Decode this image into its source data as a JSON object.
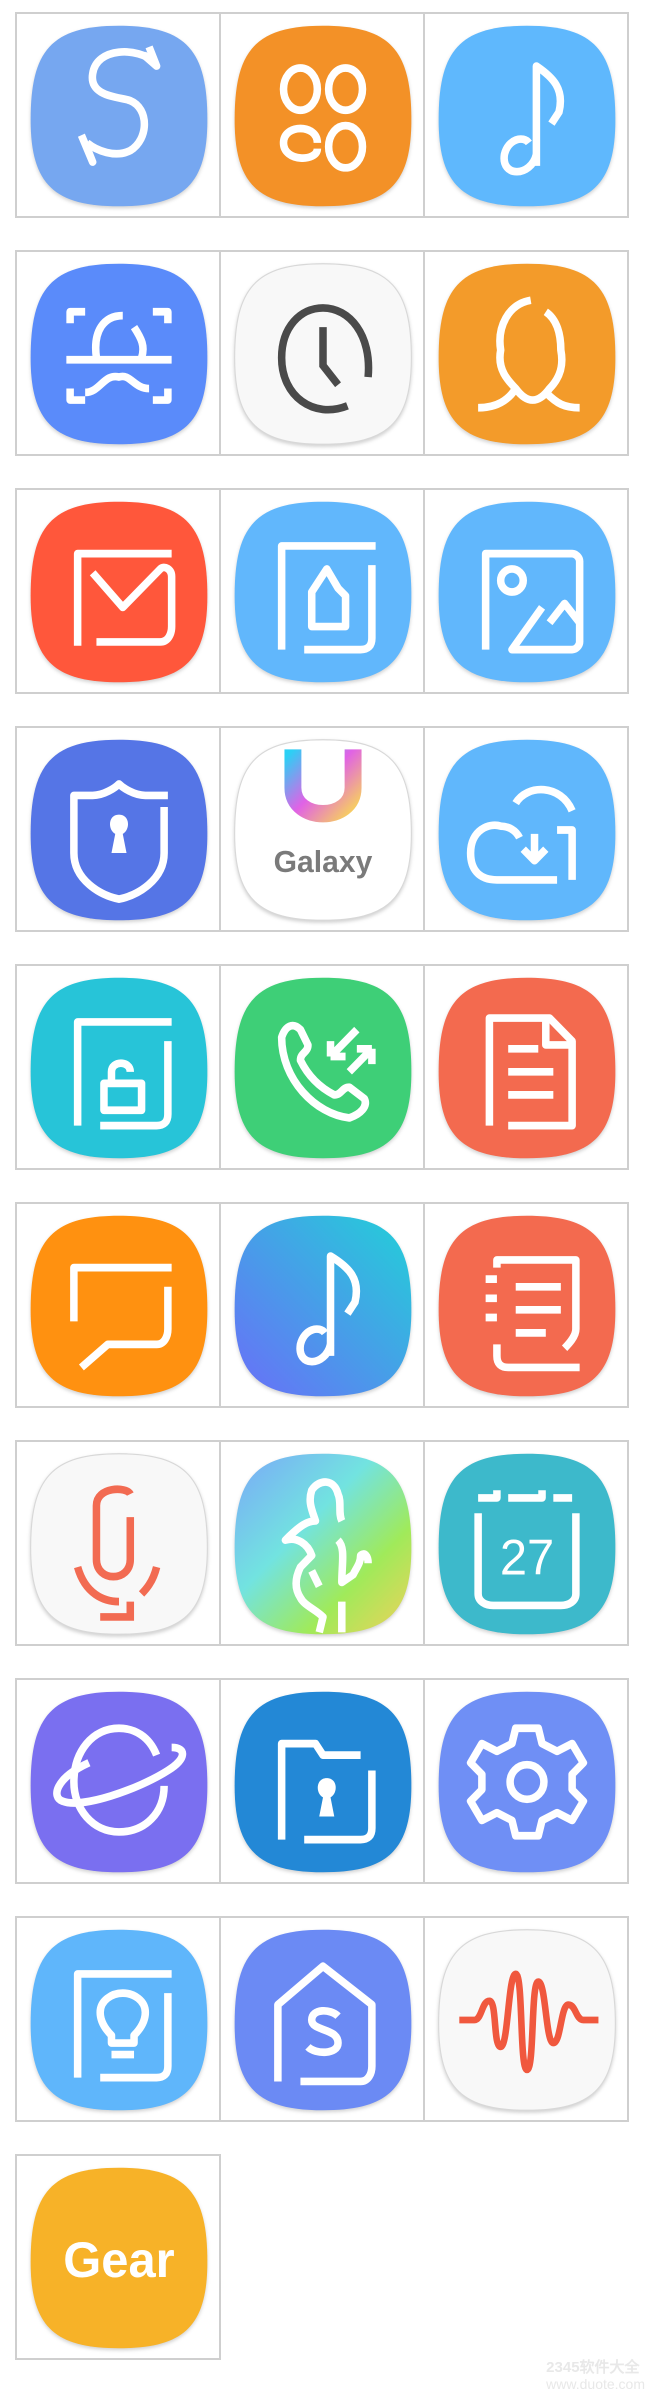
{
  "icons": [
    {
      "name": "samsung-switch-icon",
      "color": "#76a7f0"
    },
    {
      "name": "galaxy-apps-icon",
      "color": "#f39127"
    },
    {
      "name": "music-icon",
      "color": "#5fb8fd"
    },
    {
      "name": "face-scan-icon",
      "color": "#5a8bfa"
    },
    {
      "name": "clock-icon",
      "color": "#f8f8f8"
    },
    {
      "name": "face-recognition-icon",
      "color": "#f39b2a"
    },
    {
      "name": "email-icon",
      "color": "#ff573b"
    },
    {
      "name": "home-frame-icon",
      "color": "#61b7fc"
    },
    {
      "name": "gallery-icon",
      "color": "#61b7fc"
    },
    {
      "name": "secure-shield-icon",
      "color": "#5575e6"
    },
    {
      "name": "galaxy-store-icon",
      "color": "#ffffff",
      "label": "Galaxy"
    },
    {
      "name": "cloud-sync-icon",
      "color": "#60b7fc"
    },
    {
      "name": "secure-folder-icon",
      "color": "#27c4d8"
    },
    {
      "name": "call-forward-icon",
      "color": "#3ecf77"
    },
    {
      "name": "document-icon",
      "color": "#f36a4f"
    },
    {
      "name": "message-icon",
      "color": "#ff9110"
    },
    {
      "name": "music-gradient-icon",
      "color": "#5a9cf8"
    },
    {
      "name": "notes-icon",
      "color": "#f36a4f"
    },
    {
      "name": "voice-recorder-icon",
      "color": "#f8f8f8"
    },
    {
      "name": "health-icon",
      "color": "#9fd86a"
    },
    {
      "name": "calendar-icon",
      "color": "#3db9cb",
      "label": "27"
    },
    {
      "name": "internet-planet-icon",
      "color": "#7a6ff0"
    },
    {
      "name": "my-files-icon",
      "color": "#2388d6"
    },
    {
      "name": "settings-gear-icon",
      "color": "#6f8ff5"
    },
    {
      "name": "tips-bulb-icon",
      "color": "#5fb6fb"
    },
    {
      "name": "smart-home-icon",
      "color": "#6b8af4"
    },
    {
      "name": "sound-wave-icon",
      "color": "#f8f8f8"
    },
    {
      "name": "gear-app-icon",
      "color": "#f7b228",
      "label": "Gear"
    }
  ],
  "watermark": {
    "line1": "2345软件大全",
    "line2": "www.duote.com"
  }
}
